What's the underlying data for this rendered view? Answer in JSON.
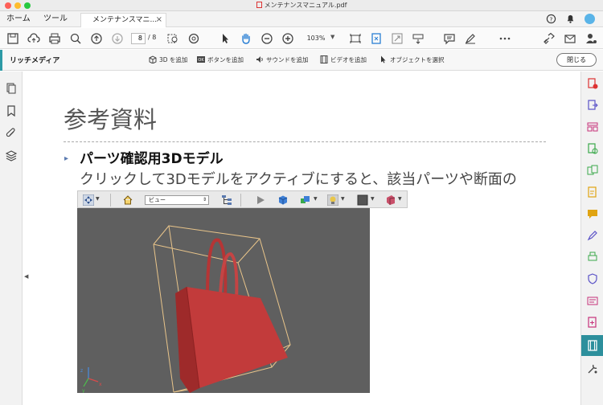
{
  "window": {
    "title": "メンテナンスマニュアル.pdf"
  },
  "tabs": {
    "home": "ホーム",
    "tools": "ツール",
    "document": "メンテナンスマニ...",
    "close_symbol": "×"
  },
  "toolbar": {
    "page_current": "8",
    "page_total": "/ 8",
    "zoom": "103%"
  },
  "richmedia": {
    "title": "リッチメディア",
    "items": [
      {
        "label": "3D を追加",
        "icon": "cube-icon"
      },
      {
        "label": "ボタンを追加",
        "icon": "ok-button-icon"
      },
      {
        "label": "サウンドを追加",
        "icon": "speaker-icon"
      },
      {
        "label": "ビデオを追加",
        "icon": "film-icon"
      },
      {
        "label": "オブジェクトを選択",
        "icon": "cursor-icon"
      }
    ],
    "close_label": "閉じる"
  },
  "document": {
    "heading": "参考資料",
    "bullet": "▸",
    "subheading": "パーツ確認用3Dモデル",
    "body": "クリックして3Dモデルをアクティブにすると、該当パーツや断面の"
  },
  "viewer3d": {
    "view_select": "ビュー"
  },
  "colors": {
    "accent": "#2d9aa6",
    "active_tool": "#2d8f9c",
    "viewport_bg": "#5f5f5f",
    "bag": "#c23b3b"
  }
}
